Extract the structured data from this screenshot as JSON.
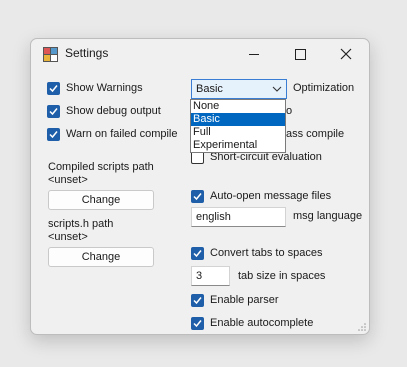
{
  "window": {
    "title": "Settings"
  },
  "titlebar": {
    "minimize_icon": "minimize-icon",
    "maximize_icon": "maximize-icon",
    "close_icon": "close-icon"
  },
  "colors": {
    "checkbox_accent": "#1f5ea8",
    "selection": "#0067c0",
    "combo_focus": "#3a7ed4"
  },
  "left": {
    "show_warnings": {
      "label": "Show Warnings",
      "checked": true
    },
    "show_debug": {
      "label": "Show debug output",
      "checked": true
    },
    "warn_failed": {
      "label": "Warn on failed compile",
      "checked": true
    },
    "compiled_path": {
      "label": "Compiled scripts path",
      "value": "<unset>",
      "button": "Change"
    },
    "scripts_h": {
      "label": "scripts.h path",
      "value": "<unset>",
      "button": "Change"
    }
  },
  "right": {
    "optimization": {
      "label": "Optimization",
      "selected": "Basic",
      "options": [
        "None",
        "Basic",
        "Full",
        "Experimental"
      ]
    },
    "hidden_fragment_1": "o",
    "hidden_fragment_2": "ass compile",
    "short_circuit": {
      "label": "Short-circuit evaluation",
      "checked": false
    },
    "auto_open": {
      "label": "Auto-open message files",
      "checked": true
    },
    "msg_language": {
      "value": "english",
      "label": "msg language"
    },
    "convert_tabs": {
      "label": "Convert tabs to spaces",
      "checked": true
    },
    "tab_size": {
      "value": "3",
      "label": "tab size in spaces"
    },
    "enable_parser": {
      "label": "Enable parser",
      "checked": true
    },
    "enable_autocomplete": {
      "label": "Enable autocomplete",
      "checked": true
    }
  }
}
